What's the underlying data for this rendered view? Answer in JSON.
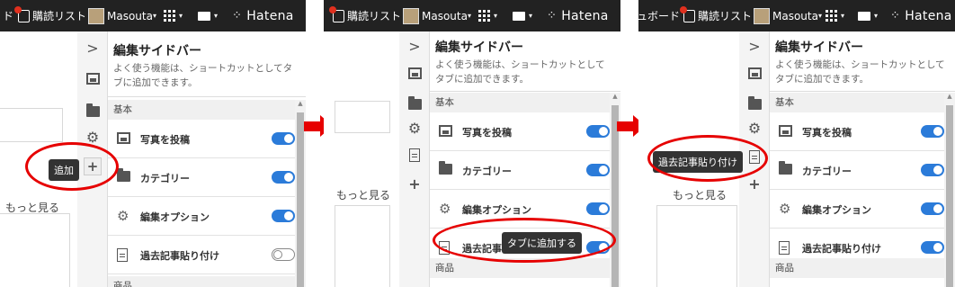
{
  "topbar": {
    "dashboard_fragment": "ュボード",
    "fragment_p1": "ド",
    "reading_list": "購読リスト",
    "user": "Masouta",
    "brand": "Hatena"
  },
  "page": {
    "more_label": "もっと見る"
  },
  "sidebar": {
    "title": "編集サイドバー",
    "description": "よく使う機能は、ショートカットとしてタブに追加できます。",
    "section_basic": "基本",
    "section_products": "商品",
    "items": [
      {
        "label": "写真を投稿",
        "icon": "image-icon",
        "enabled": true
      },
      {
        "label": "カテゴリー",
        "icon": "folder-icon",
        "enabled": true
      },
      {
        "label": "編集オプション",
        "icon": "gear-icon",
        "enabled": true
      },
      {
        "label": "過去記事貼り付け",
        "icon": "document-icon",
        "enabled": false
      }
    ],
    "item3_label_truncated": "過去記事"
  },
  "tooltips": {
    "add": "追加",
    "add_to_tab": "タブに追加する",
    "past_article": "過去記事貼り付け"
  },
  "colors": {
    "accent": "#2b7bd9",
    "highlight": "#e60000",
    "topbar": "#222222"
  }
}
